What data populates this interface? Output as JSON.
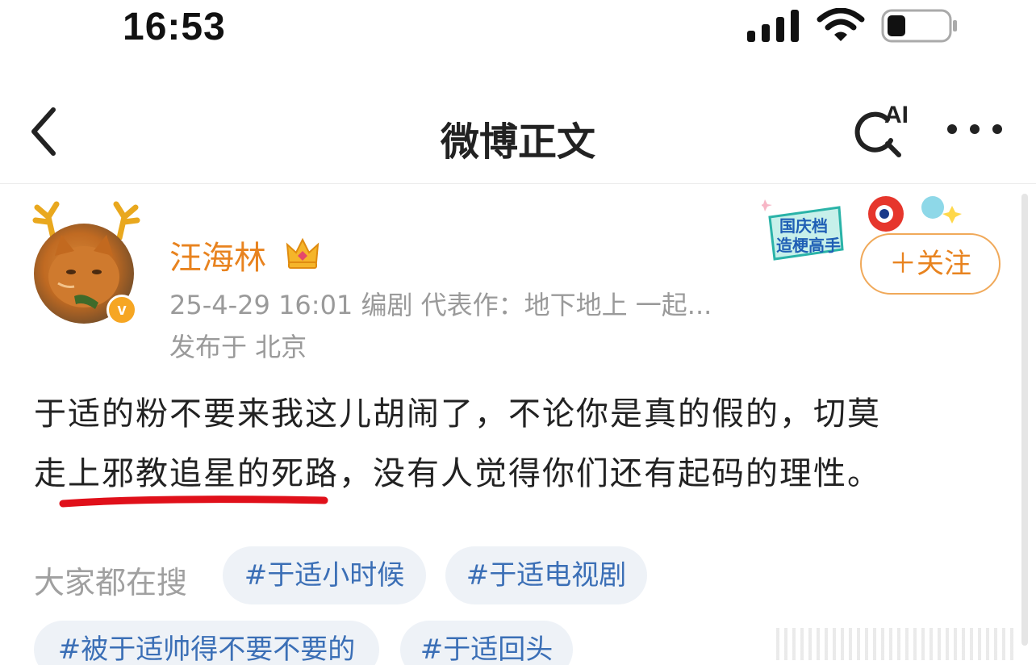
{
  "status_bar": {
    "time": "16:53"
  },
  "header": {
    "title": "微博正文",
    "ai_label": "AI"
  },
  "post": {
    "author": "汪海林",
    "avatar_badge": "v",
    "meta": "25-4-29 16:01  编剧 代表作：地下地上 一起...",
    "location": "发布于 北京",
    "follow_label": "＋关注",
    "event_badge_lines": [
      "国庆档",
      "造梗高手"
    ],
    "text_line_1": "于适的粉不要来我这儿胡闹了，不论你是真的假的，切莫",
    "text_line_2": "走上邪教追星的死路，没有人觉得你们还有起码的理性。"
  },
  "related_search": {
    "label": "大家都在搜",
    "tags": [
      "#于适小时候",
      "#于适电视剧",
      "#被于适帅得不要不要的",
      "#于适回头"
    ]
  },
  "colors": {
    "accent": "#e8831f",
    "tag_text": "#3b6fb6",
    "tag_bg": "#eef2f7",
    "underline": "#e0101a"
  },
  "icons": {
    "back": "chevron-left-icon",
    "ai_search": "ai-search-icon",
    "more": "more-dots-icon",
    "crown": "crown-icon"
  }
}
